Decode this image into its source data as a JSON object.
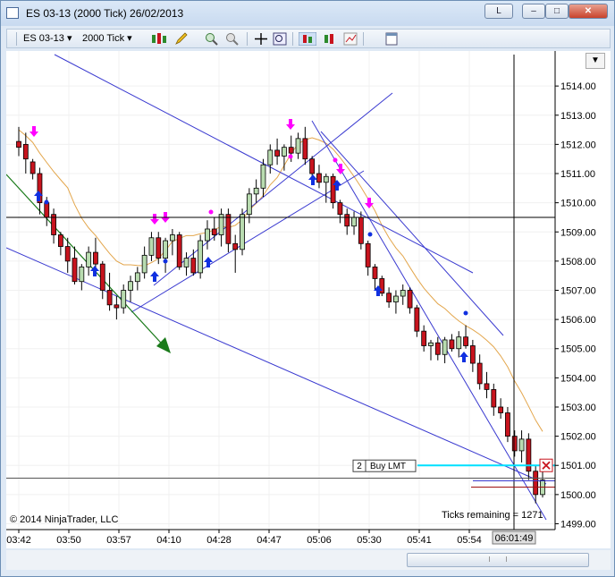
{
  "window": {
    "title": "ES 03-13 (2000 Tick)  26/02/2013",
    "btn_link": "L",
    "btn_min": "–",
    "btn_max": "□",
    "btn_close": "✕"
  },
  "toolbar": {
    "instrument": "ES 03-13",
    "interval": "2000 Tick",
    "icons": [
      "bar-type-icon",
      "pencil-draw-icon",
      "zoom-in-icon",
      "zoom-out-icon",
      "crosshair-icon",
      "magnifier-icon",
      "strategy-icon",
      "indicator-icon",
      "chart-style-icon",
      "properties-icon"
    ]
  },
  "chart": {
    "copyright": "© 2014 NinjaTrader, LLC",
    "ticks_remaining": "Ticks remaining = 1271",
    "crosshair_time": "06:01:49",
    "crosshair_price": "1509.50",
    "last_price": "1500.50",
    "order_price": "1501.00",
    "order_qty": "2",
    "order_type": "Buy LMT",
    "x_labels": [
      "03:42",
      "03:50",
      "03:57",
      "04:10",
      "04:28",
      "04:47",
      "05:06",
      "05:30",
      "05:41",
      "05:54"
    ],
    "y_labels": [
      "1514.00",
      "1513.00",
      "1512.00",
      "1511.00",
      "1510.00",
      "1509.00",
      "1508.00",
      "1507.00",
      "1506.00",
      "1505.00",
      "1504.00",
      "1503.00",
      "1502.00",
      "1501.00",
      "1500.00",
      "1499.00"
    ],
    "colors": {
      "up": "#b9dcb0",
      "down": "#c8141e",
      "trend": "#3a3ad0",
      "sma": "#e3a64c",
      "arrow_up": "#1030e0",
      "arrow_down": "#ff00ff",
      "order": "#00e0ff",
      "green_arrow": "#1a7a1a"
    }
  },
  "chart_data": {
    "type": "candlestick",
    "y_range": [
      1498.8,
      1515.2
    ],
    "bars": [
      [
        1512.1,
        1512.6,
        1511.6,
        1511.9
      ],
      [
        1512.0,
        1512.4,
        1511.0,
        1511.5
      ],
      [
        1511.4,
        1511.5,
        1510.8,
        1511.0
      ],
      [
        1511.0,
        1511.2,
        1509.6,
        1510.0
      ],
      [
        1510.0,
        1510.2,
        1509.2,
        1509.5
      ],
      [
        1509.6,
        1509.8,
        1508.6,
        1508.9
      ],
      [
        1508.9,
        1509.0,
        1508.2,
        1508.5
      ],
      [
        1508.5,
        1508.8,
        1507.6,
        1508.0
      ],
      [
        1508.1,
        1508.5,
        1507.2,
        1507.3
      ],
      [
        1507.3,
        1507.9,
        1507.0,
        1507.8
      ],
      [
        1507.8,
        1508.5,
        1507.5,
        1508.3
      ],
      [
        1508.3,
        1508.8,
        1507.6,
        1507.9
      ],
      [
        1507.9,
        1508.0,
        1506.7,
        1507.0
      ],
      [
        1507.0,
        1507.6,
        1506.3,
        1506.5
      ],
      [
        1506.5,
        1506.8,
        1506.0,
        1506.4
      ],
      [
        1506.4,
        1507.2,
        1506.2,
        1507.0
      ],
      [
        1507.0,
        1507.5,
        1506.6,
        1507.3
      ],
      [
        1507.3,
        1507.8,
        1507.0,
        1507.6
      ],
      [
        1507.6,
        1508.5,
        1507.4,
        1508.2
      ],
      [
        1508.2,
        1509.0,
        1508.0,
        1508.8
      ],
      [
        1508.8,
        1509.0,
        1507.9,
        1508.1
      ],
      [
        1508.1,
        1508.8,
        1507.6,
        1508.7
      ],
      [
        1508.7,
        1509.1,
        1508.2,
        1508.9
      ],
      [
        1508.9,
        1509.0,
        1507.7,
        1507.8
      ],
      [
        1507.8,
        1508.3,
        1507.5,
        1508.1
      ],
      [
        1508.1,
        1508.4,
        1507.5,
        1507.6
      ],
      [
        1507.6,
        1508.9,
        1507.4,
        1508.7
      ],
      [
        1508.7,
        1509.4,
        1508.4,
        1509.1
      ],
      [
        1509.1,
        1509.5,
        1508.7,
        1508.9
      ],
      [
        1508.9,
        1509.8,
        1508.5,
        1509.6
      ],
      [
        1509.6,
        1509.8,
        1508.3,
        1508.6
      ],
      [
        1508.6,
        1508.9,
        1507.6,
        1508.4
      ],
      [
        1508.4,
        1509.8,
        1508.2,
        1509.6
      ],
      [
        1509.6,
        1510.5,
        1509.3,
        1510.3
      ],
      [
        1510.3,
        1510.8,
        1510.0,
        1510.5
      ],
      [
        1510.5,
        1511.5,
        1510.2,
        1511.3
      ],
      [
        1511.3,
        1512.0,
        1511.0,
        1511.8
      ],
      [
        1511.8,
        1512.2,
        1511.3,
        1511.6
      ],
      [
        1511.6,
        1512.0,
        1511.1,
        1511.9
      ],
      [
        1511.9,
        1512.3,
        1511.4,
        1511.7
      ],
      [
        1511.7,
        1512.4,
        1511.5,
        1512.2
      ],
      [
        1512.2,
        1512.6,
        1511.3,
        1511.5
      ],
      [
        1511.5,
        1511.6,
        1510.8,
        1511.0
      ],
      [
        1511.0,
        1511.3,
        1510.5,
        1510.7
      ],
      [
        1510.7,
        1511.0,
        1510.0,
        1510.9
      ],
      [
        1510.9,
        1511.0,
        1509.8,
        1510.0
      ],
      [
        1510.0,
        1510.1,
        1509.3,
        1509.6
      ],
      [
        1509.6,
        1509.8,
        1508.9,
        1509.2
      ],
      [
        1509.2,
        1509.7,
        1508.9,
        1509.5
      ],
      [
        1509.5,
        1509.7,
        1508.4,
        1508.6
      ],
      [
        1508.6,
        1508.7,
        1507.5,
        1507.8
      ],
      [
        1507.8,
        1507.9,
        1507.0,
        1507.4
      ],
      [
        1507.4,
        1507.5,
        1506.8,
        1506.9
      ],
      [
        1506.9,
        1507.1,
        1506.4,
        1506.6
      ],
      [
        1506.6,
        1507.0,
        1506.2,
        1506.8
      ],
      [
        1506.8,
        1507.2,
        1506.5,
        1507.0
      ],
      [
        1507.0,
        1507.1,
        1506.2,
        1506.4
      ],
      [
        1506.4,
        1506.5,
        1505.4,
        1505.6
      ],
      [
        1505.6,
        1505.8,
        1504.9,
        1505.1
      ],
      [
        1505.1,
        1505.3,
        1504.6,
        1505.2
      ],
      [
        1505.2,
        1505.4,
        1504.6,
        1504.8
      ],
      [
        1504.8,
        1505.4,
        1504.5,
        1505.3
      ],
      [
        1505.3,
        1505.5,
        1504.9,
        1505.0
      ],
      [
        1505.0,
        1505.6,
        1504.7,
        1505.4
      ],
      [
        1505.4,
        1505.8,
        1505.0,
        1505.1
      ],
      [
        1505.1,
        1505.3,
        1504.2,
        1504.5
      ],
      [
        1504.5,
        1504.8,
        1503.6,
        1503.8
      ],
      [
        1503.8,
        1504.2,
        1503.3,
        1503.6
      ],
      [
        1503.6,
        1503.8,
        1502.7,
        1503.0
      ],
      [
        1503.0,
        1503.3,
        1502.6,
        1502.8
      ],
      [
        1502.8,
        1503.0,
        1501.8,
        1502.0
      ],
      [
        1502.0,
        1502.2,
        1501.3,
        1501.5
      ],
      [
        1501.5,
        1502.2,
        1501.1,
        1501.9
      ],
      [
        1501.9,
        1502.1,
        1500.5,
        1500.8
      ],
      [
        1500.8,
        1501.0,
        1499.7,
        1500.0
      ],
      [
        1500.0,
        1500.8,
        1499.9,
        1500.5
      ]
    ]
  }
}
